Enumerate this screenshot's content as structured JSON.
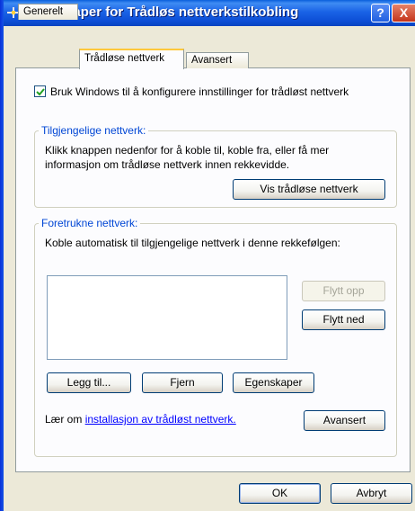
{
  "window": {
    "title": "Egenskaper for Trådløs nettverkstilkobling",
    "help_label": "?",
    "close_label": "X"
  },
  "tabs": [
    {
      "label": "Generelt"
    },
    {
      "label": "Trådløse nettverk"
    },
    {
      "label": "Avansert"
    }
  ],
  "use_windows": {
    "label": "Bruk Windows til å konfigurere innstillinger for trådløst nettverk",
    "checked": true
  },
  "available": {
    "legend": "Tilgjengelige nettverk:",
    "line1": "Klikk knappen nedenfor for å koble til, koble fra, eller få mer",
    "line2": "informasjon om trådløse nettverk innen rekkevidde.",
    "view_button": "Vis trådløse nettverk"
  },
  "preferred": {
    "legend": "Foretrukne nettverk:",
    "description": "Koble automatisk til tilgjengelige nettverk i denne rekkefølgen:",
    "move_up": "Flytt opp",
    "move_down": "Flytt ned",
    "add": "Legg til...",
    "remove": "Fjern",
    "properties": "Egenskaper",
    "learn_prefix": "Lær om ",
    "learn_link": "installasjon av trådløst nettverk.",
    "advanced": "Avansert"
  },
  "footer": {
    "ok": "OK",
    "cancel": "Avbryt"
  },
  "colors": {
    "titlebar": "#0a5fdc",
    "legend": "#0046d5",
    "tab_highlight": "#ffc83c"
  }
}
